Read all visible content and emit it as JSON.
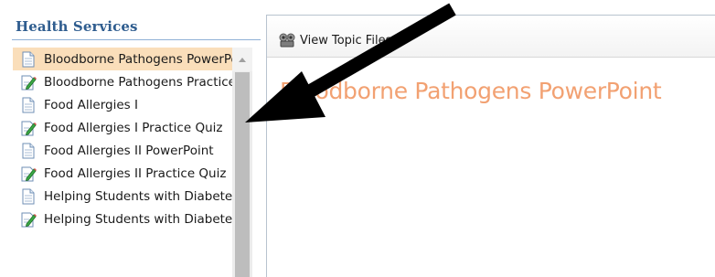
{
  "sidebar": {
    "title": "Health Services",
    "items": [
      {
        "label": "Bloodborne Pathogens PowerPoint",
        "icon": "document-icon",
        "selected": true
      },
      {
        "label": "Bloodborne Pathogens Practice Quiz",
        "icon": "edit-document-icon",
        "selected": false
      },
      {
        "label": "Food Allergies I",
        "icon": "document-icon",
        "selected": false
      },
      {
        "label": "Food Allergies I Practice Quiz",
        "icon": "edit-document-icon",
        "selected": false
      },
      {
        "label": "Food Allergies II PowerPoint",
        "icon": "document-icon",
        "selected": false
      },
      {
        "label": "Food Allergies II Practice Quiz",
        "icon": "edit-document-icon",
        "selected": false
      },
      {
        "label": "Helping Students with Diabetes",
        "icon": "document-icon",
        "selected": false
      },
      {
        "label": "Helping Students with Diabetes Practice Quiz",
        "icon": "edit-document-icon",
        "selected": false
      }
    ]
  },
  "toolbar": {
    "view_files_label": "View Topic Files",
    "view_files_icon": "view-files-icon"
  },
  "content": {
    "topic_title": "Bloodborne Pathogens PowerPoint",
    "title_color": "#f2a172"
  },
  "colors": {
    "sidebar_title": "#2f5d8f",
    "selected_row": "#fadeba",
    "edit_icon_accent": "#2e9d3a",
    "arrow": "#000000"
  }
}
